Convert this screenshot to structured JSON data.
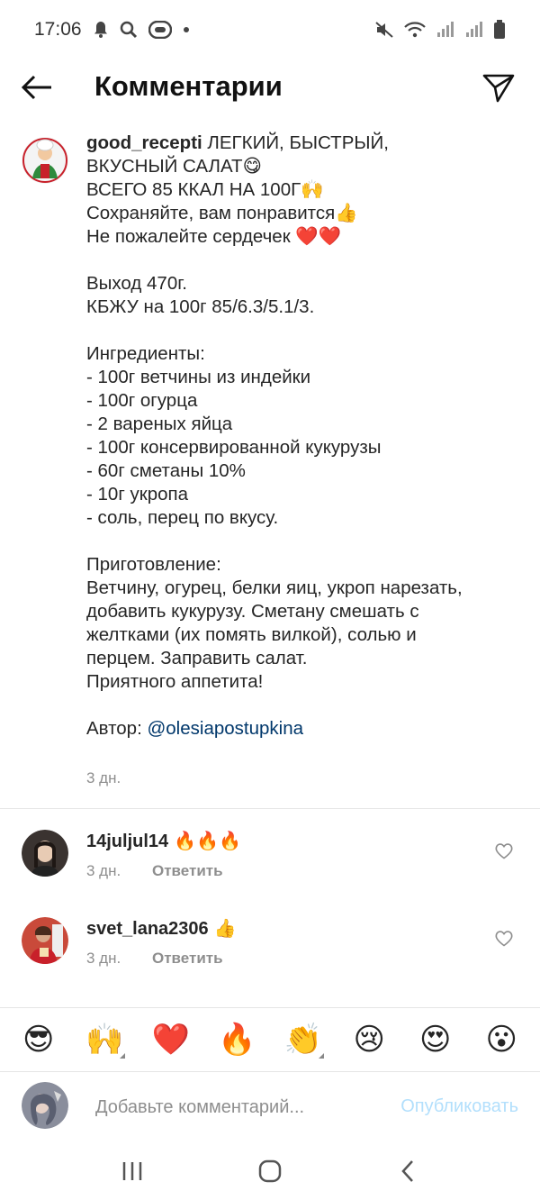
{
  "status": {
    "time": "17:06"
  },
  "header": {
    "title": "Комментарии"
  },
  "caption": {
    "username": "good_recepti",
    "lines": [
      "ЛЕГКИЙ, БЫСТРЫЙ,",
      "ВКУСНЫЙ САЛАТ😋",
      "ВСЕГО 85 ККАЛ НА 100Г🙌",
      "Сохраняйте, вам понравится👍",
      "Не пожалейте сердечек ❤️❤️",
      "",
      "Выход 470г.",
      "КБЖУ на 100г 85/6.3/5.1/3.",
      "",
      "Ингредиенты:",
      "- 100г ветчины из индейки",
      "- 100г огурца",
      "- 2 вареных яйца",
      "- 100г консервированной кукурузы",
      "- 60г сметаны 10%",
      "- 10г укропа",
      "- соль, перец по вкусу.",
      "",
      "Приготовление:",
      "Ветчину, огурец, белки яиц, укроп нарезать,",
      "добавить кукурузу. Сметану смешать с",
      "желтками (их помять вилкой), солью и",
      "перцем. Заправить салат.",
      "Приятного аппетита!",
      "",
      "Автор: "
    ],
    "author_link": "@olesiapostupkina",
    "time": "3 дн."
  },
  "comments": [
    {
      "username": "14juljul14",
      "emoji": "🔥🔥🔥",
      "time": "3 дн.",
      "reply": "Ответить"
    },
    {
      "username": "svet_lana2306",
      "emoji": "👍",
      "time": "3 дн.",
      "reply": "Ответить"
    }
  ],
  "emoji_bar": [
    "😎",
    "🙌",
    "❤️",
    "🔥",
    "👏",
    "😢",
    "😍",
    "😮"
  ],
  "input": {
    "placeholder": "Добавьте комментарий...",
    "publish": "Опубликовать"
  },
  "icons": {
    "back": "arrow-left-icon",
    "share": "paper-plane-icon",
    "like": "heart-outline-icon"
  },
  "colors": {
    "link": "#00376b",
    "muted": "#8e8e8e",
    "publish_disabled": "#b2dffc"
  }
}
